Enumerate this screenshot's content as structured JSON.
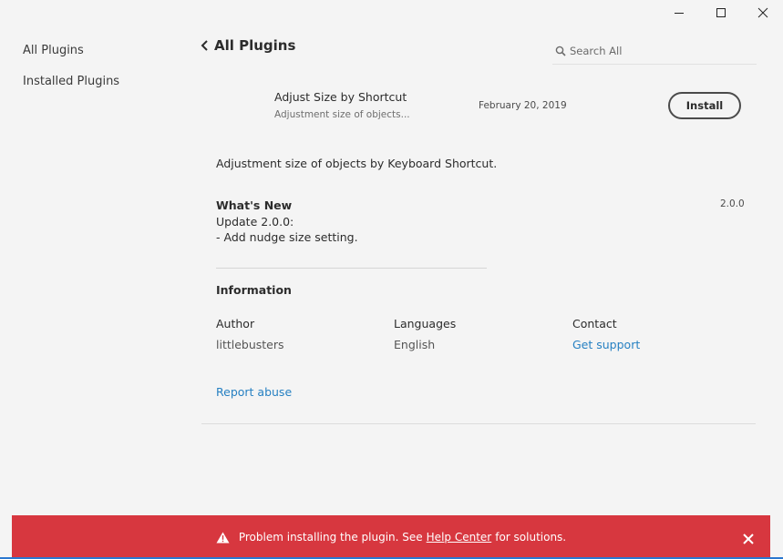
{
  "window": {
    "icons": {
      "minimize": "minimize-icon",
      "maximize": "maximize-icon",
      "close": "close-icon"
    }
  },
  "sidebar": {
    "items": [
      {
        "label": "All Plugins"
      },
      {
        "label": "Installed Plugins"
      }
    ]
  },
  "header": {
    "back_icon": "chevron-left-icon",
    "title": "All Plugins",
    "search_placeholder": "Search All",
    "search_icon": "search-icon"
  },
  "plugin": {
    "name": "Adjust Size by Shortcut",
    "short_description": "Adjustment size of objects...",
    "date": "February 20, 2019",
    "install_label": "Install",
    "description": "Adjustment size of objects by Keyboard Shortcut.",
    "whats_new": {
      "title": "What's New",
      "version": "2.0.0",
      "lines": [
        "Update 2.0.0:",
        "- Add nudge size setting."
      ]
    },
    "information": {
      "title": "Information",
      "author_label": "Author",
      "author": "littlebusters",
      "languages_label": "Languages",
      "languages": "English",
      "contact_label": "Contact",
      "contact": "Get support"
    },
    "report_abuse": "Report abuse"
  },
  "toast": {
    "icon": "warning-icon",
    "message_prefix": "Problem installing the plugin. See",
    "link": "Help Center",
    "message_suffix": "for solutions.",
    "close_icon": "close-icon",
    "color": "#d7373f"
  },
  "colors": {
    "background": "#f4f4f4",
    "link": "#2680c2",
    "error": "#d7373f"
  }
}
